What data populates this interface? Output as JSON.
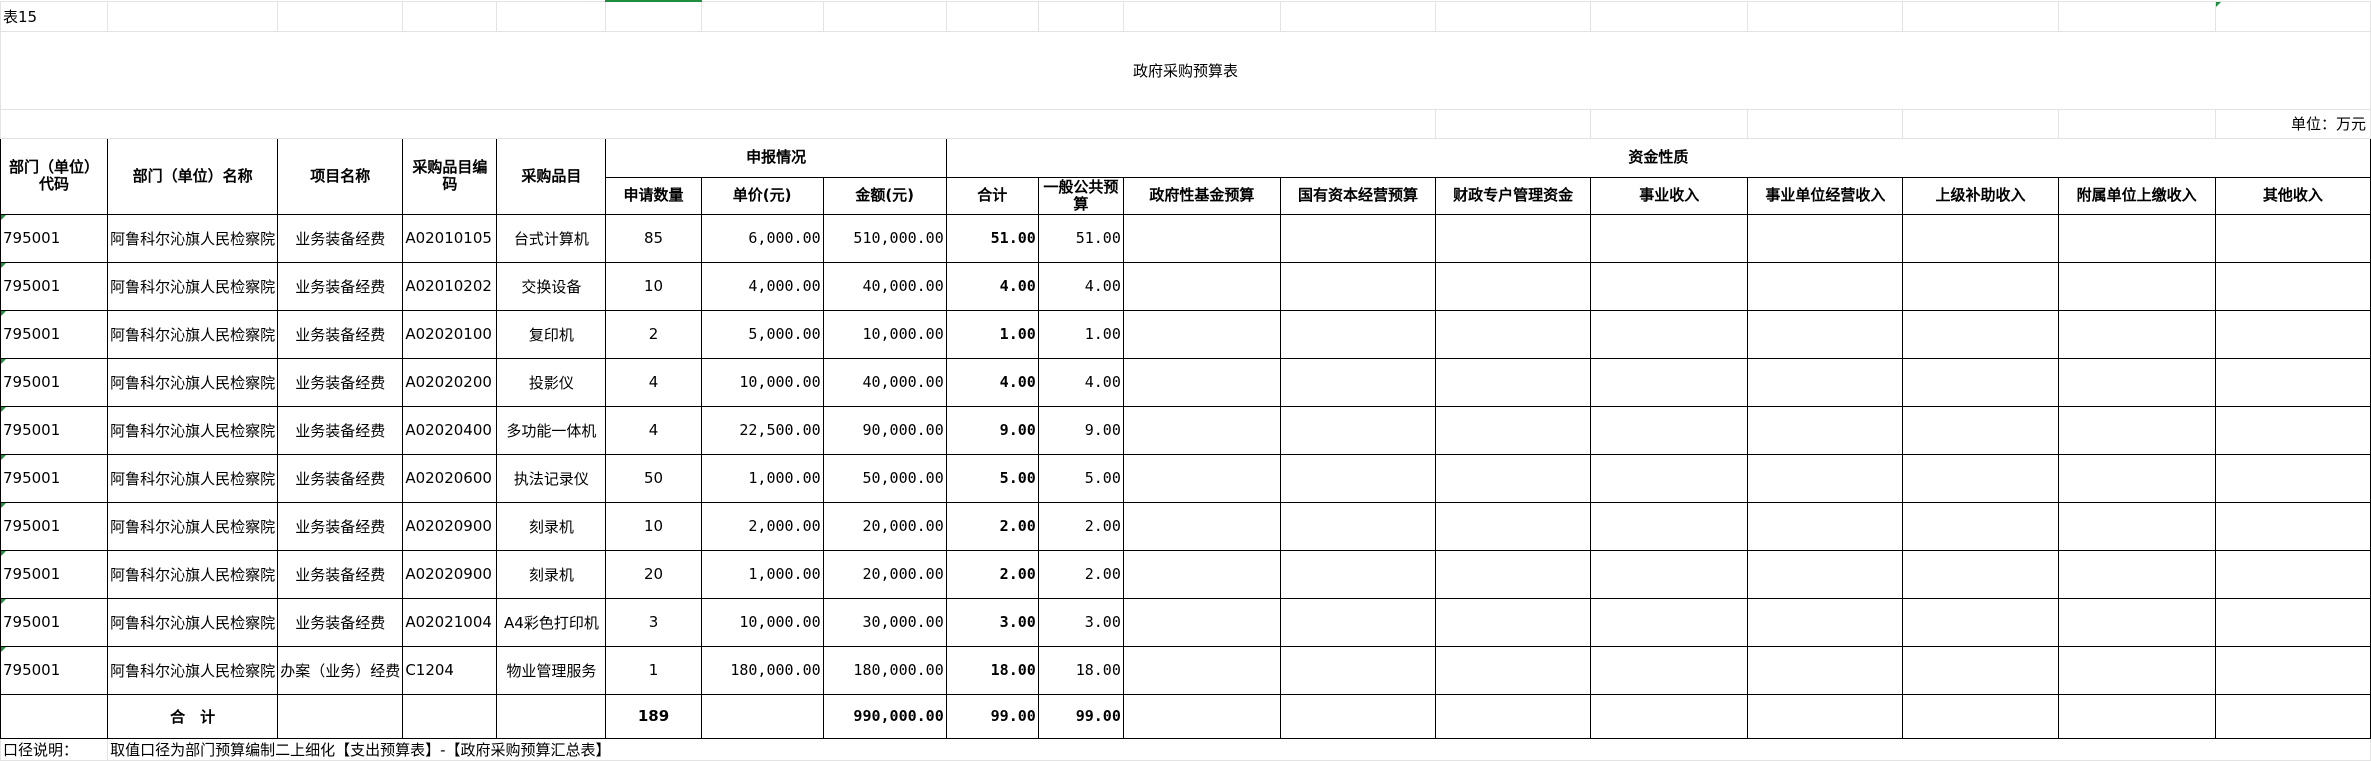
{
  "sheet": {
    "sheet_tag": "表15",
    "title": "政府采购预算表",
    "unit": "单位：万元"
  },
  "headers": {
    "dept_code": "部门（单位）代码",
    "dept_name": "部门（单位）名称",
    "project_name": "项目名称",
    "item_code": "采购品目编码",
    "item": "采购品目",
    "declare_group": "申报情况",
    "quantity": "申请数量",
    "unit_price": "单价(元)",
    "amount": "金额(元)",
    "fund_group": "资金性质",
    "total": "合计",
    "general_budget": "一般公共预算",
    "gov_fund": "政府性基金预算",
    "state_capital": "国有资本经营预算",
    "fiscal_account": "财政专户管理资金",
    "business_income": "事业收入",
    "business_operating": "事业单位经营收入",
    "superior_subsidy": "上级补助收入",
    "affiliated_income": "附属单位上缴收入",
    "other_income": "其他收入"
  },
  "rows": [
    {
      "dept_code": "795001",
      "dept_name": "阿鲁科尔沁旗人民检察院",
      "project": "业务装备经费",
      "item_code": "A02010105",
      "item": "台式计算机",
      "qty": "85",
      "price": "6,000.00",
      "amount": "510,000.00",
      "total": "51.00",
      "general": "51.00"
    },
    {
      "dept_code": "795001",
      "dept_name": "阿鲁科尔沁旗人民检察院",
      "project": "业务装备经费",
      "item_code": "A02010202",
      "item": "交换设备",
      "qty": "10",
      "price": "4,000.00",
      "amount": "40,000.00",
      "total": "4.00",
      "general": "4.00"
    },
    {
      "dept_code": "795001",
      "dept_name": "阿鲁科尔沁旗人民检察院",
      "project": "业务装备经费",
      "item_code": "A02020100",
      "item": "复印机",
      "qty": "2",
      "price": "5,000.00",
      "amount": "10,000.00",
      "total": "1.00",
      "general": "1.00"
    },
    {
      "dept_code": "795001",
      "dept_name": "阿鲁科尔沁旗人民检察院",
      "project": "业务装备经费",
      "item_code": "A02020200",
      "item": "投影仪",
      "qty": "4",
      "price": "10,000.00",
      "amount": "40,000.00",
      "total": "4.00",
      "general": "4.00"
    },
    {
      "dept_code": "795001",
      "dept_name": "阿鲁科尔沁旗人民检察院",
      "project": "业务装备经费",
      "item_code": "A02020400",
      "item": "多功能一体机",
      "qty": "4",
      "price": "22,500.00",
      "amount": "90,000.00",
      "total": "9.00",
      "general": "9.00"
    },
    {
      "dept_code": "795001",
      "dept_name": "阿鲁科尔沁旗人民检察院",
      "project": "业务装备经费",
      "item_code": "A02020600",
      "item": "执法记录仪",
      "qty": "50",
      "price": "1,000.00",
      "amount": "50,000.00",
      "total": "5.00",
      "general": "5.00"
    },
    {
      "dept_code": "795001",
      "dept_name": "阿鲁科尔沁旗人民检察院",
      "project": "业务装备经费",
      "item_code": "A02020900",
      "item": "刻录机",
      "qty": "10",
      "price": "2,000.00",
      "amount": "20,000.00",
      "total": "2.00",
      "general": "2.00"
    },
    {
      "dept_code": "795001",
      "dept_name": "阿鲁科尔沁旗人民检察院",
      "project": "业务装备经费",
      "item_code": "A02020900",
      "item": "刻录机",
      "qty": "20",
      "price": "1,000.00",
      "amount": "20,000.00",
      "total": "2.00",
      "general": "2.00"
    },
    {
      "dept_code": "795001",
      "dept_name": "阿鲁科尔沁旗人民检察院",
      "project": "业务装备经费",
      "item_code": "A02021004",
      "item": "A4彩色打印机",
      "qty": "3",
      "price": "10,000.00",
      "amount": "30,000.00",
      "total": "3.00",
      "general": "3.00"
    },
    {
      "dept_code": "795001",
      "dept_name": "阿鲁科尔沁旗人民检察院",
      "project": "办案（业务）经费",
      "item_code": "C1204",
      "item": "物业管理服务",
      "qty": "1",
      "price": "180,000.00",
      "amount": "180,000.00",
      "total": "18.00",
      "general": "18.00"
    }
  ],
  "totals": {
    "label": "合　计",
    "qty": "189",
    "amount": "990,000.00",
    "total": "99.00",
    "general": "99.00"
  },
  "footer": {
    "label": "口径说明：",
    "text": "取值口径为部门预算编制二上细化【支出预算表】-【政府采购预算汇总表】"
  }
}
